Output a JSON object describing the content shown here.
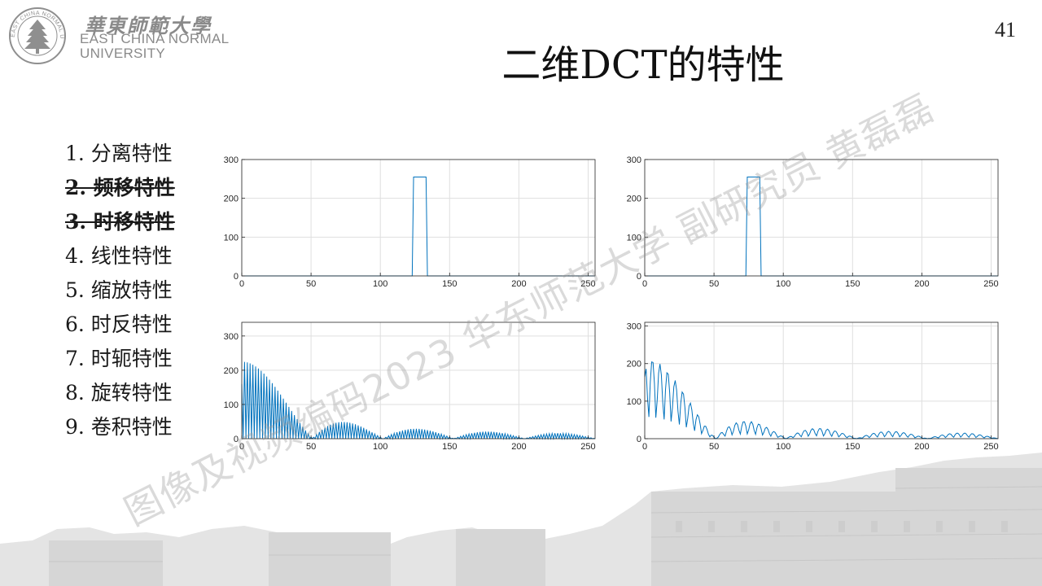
{
  "slide": {
    "page_number": "41",
    "title": "二维DCT的特性",
    "watermark": "图像及视频编码2023 华东师范大学 副研究员 黄磊磊"
  },
  "logo": {
    "cn_name": "華東師範大學",
    "en_line1": "EAST CHINA NORMAL",
    "en_line2": "UNIVERSITY",
    "seal_text": "EAST CHINA NORMAL UNIVERSITY"
  },
  "properties": [
    {
      "label": "1. 分离特性",
      "struck": false
    },
    {
      "label": "2. 频移特性",
      "struck": true
    },
    {
      "label": "3. 时移特性",
      "struck": true
    },
    {
      "label": "4. 线性特性",
      "struck": false
    },
    {
      "label": "5. 缩放特性",
      "struck": false
    },
    {
      "label": "6. 时反特性",
      "struck": false
    },
    {
      "label": "7. 时轭特性",
      "struck": false
    },
    {
      "label": "8. 旋转特性",
      "struck": false
    },
    {
      "label": "9. 卷积特性",
      "struck": false
    }
  ],
  "colors": {
    "line": "#0072bd",
    "grid": "#dfdfdf",
    "axis": "#262626",
    "watermark": "#969696"
  },
  "chart_data": [
    {
      "type": "line",
      "id": "top-left",
      "kind": "rect",
      "pulse_start": 124,
      "pulse_end": 133,
      "height": 255,
      "xlim": [
        0,
        255
      ],
      "ylim": [
        0,
        300
      ],
      "xticks": [
        0,
        50,
        100,
        150,
        200,
        250
      ],
      "yticks": [
        0,
        100,
        200,
        300
      ],
      "grid": true
    },
    {
      "type": "line",
      "id": "top-right",
      "kind": "rect",
      "pulse_start": 74,
      "pulse_end": 83,
      "height": 255,
      "xlim": [
        0,
        255
      ],
      "ylim": [
        0,
        300
      ],
      "xticks": [
        0,
        50,
        100,
        150,
        200,
        250
      ],
      "yticks": [
        0,
        100,
        200,
        300
      ],
      "grid": true
    },
    {
      "type": "line",
      "id": "bottom-left",
      "kind": "dct-dense",
      "peak": 225,
      "lobe_width": 51,
      "xlim": [
        0,
        255
      ],
      "ylim": [
        0,
        340
      ],
      "xticks": [
        0,
        50,
        100,
        150,
        200,
        250
      ],
      "yticks": [
        0,
        100,
        200,
        300
      ],
      "grid": true
    },
    {
      "type": "line",
      "id": "bottom-right",
      "kind": "dct-sparse",
      "peak": 215,
      "lobe_width": 51,
      "xlim": [
        0,
        255
      ],
      "ylim": [
        0,
        310
      ],
      "xticks": [
        0,
        50,
        100,
        150,
        200,
        250
      ],
      "yticks": [
        0,
        100,
        200,
        300
      ],
      "grid": true
    }
  ]
}
